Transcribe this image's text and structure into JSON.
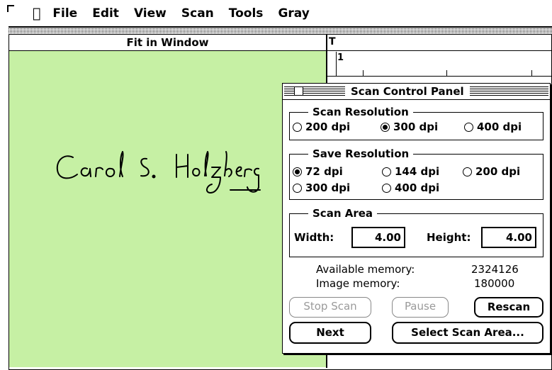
{
  "menubar": {
    "apple_icon": "apple-icon",
    "items": [
      "File",
      "Edit",
      "View",
      "Scan",
      "Tools",
      "Gray"
    ]
  },
  "image_window": {
    "title": "Fit in Window",
    "background_color": "#c6f0a4"
  },
  "ruler": {
    "corner_label": "T",
    "first_mark": "1"
  },
  "panel": {
    "title": "Scan Control Panel",
    "scan_resolution": {
      "title": "Scan Resolution",
      "options": [
        {
          "label": "200 dpi",
          "selected": false
        },
        {
          "label": "300 dpi",
          "selected": true
        },
        {
          "label": "400 dpi",
          "selected": false
        }
      ]
    },
    "save_resolution": {
      "title": "Save Resolution",
      "options": [
        {
          "label": "72 dpi",
          "selected": true
        },
        {
          "label": "144 dpi",
          "selected": false
        },
        {
          "label": "200 dpi",
          "selected": false
        },
        {
          "label": "300 dpi",
          "selected": false
        },
        {
          "label": "400 dpi",
          "selected": false
        }
      ]
    },
    "scan_area": {
      "title": "Scan Area",
      "width_label": "Width:",
      "width_value": "4.00",
      "height_label": "Height:",
      "height_value": "4.00"
    },
    "memory": {
      "available_label": "Available memory:",
      "available_value": "2324126",
      "image_label": "Image memory:",
      "image_value": "180000"
    },
    "buttons": {
      "stop_scan": "Stop Scan",
      "pause": "Pause",
      "rescan": "Rescan",
      "next": "Next",
      "select_scan_area": "Select Scan Area..."
    }
  }
}
